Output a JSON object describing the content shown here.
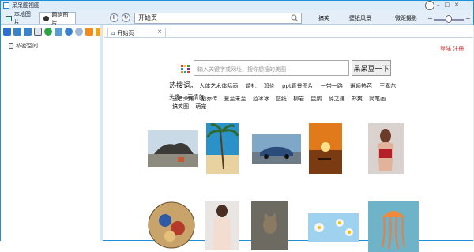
{
  "window": {
    "title": "呆呆图视图"
  },
  "toolbar": {
    "tab_local": "本地图片",
    "tab_net": "网络图片",
    "address_text": "开始页",
    "links": [
      "搞笑",
      "壁纸风景",
      "微距摄影"
    ]
  },
  "sidebar": {
    "tree": [
      {
        "label": "私密空间"
      }
    ]
  },
  "content": {
    "tab_label": "开始页",
    "tab_close": "×",
    "login_text": "登陆 注册",
    "search_placeholder": "输入关键字或网址，搜你想搜的美图",
    "search_button": "呆呆豆一下",
    "hot_label": "热搜词。",
    "hot_words_row1": [
      "人体艺术体际画",
      "婚礼",
      "邓伦",
      "ppt背景图片",
      "一带一路",
      "邂逅热芭",
      "王嘉尔",
      "头像",
      "表情包"
    ],
    "hot_words_row2": [
      "王者荣耀",
      "楚乔传",
      "夏至未至",
      "范冰冰",
      "壁纸",
      "柳岩",
      "昆鹏",
      "薛之谦",
      "郑爽",
      "简笔画",
      "搞笑图",
      "萌宠"
    ]
  },
  "colors": {
    "accent": "#1e8fd6",
    "title_bg": "#dcecf9",
    "toolbar_bg": "#e3eef8",
    "login": "#cc2222"
  },
  "icons": [
    "user-icon",
    "search-icon",
    "back-icon",
    "refresh-icon",
    "lock-icon"
  ]
}
